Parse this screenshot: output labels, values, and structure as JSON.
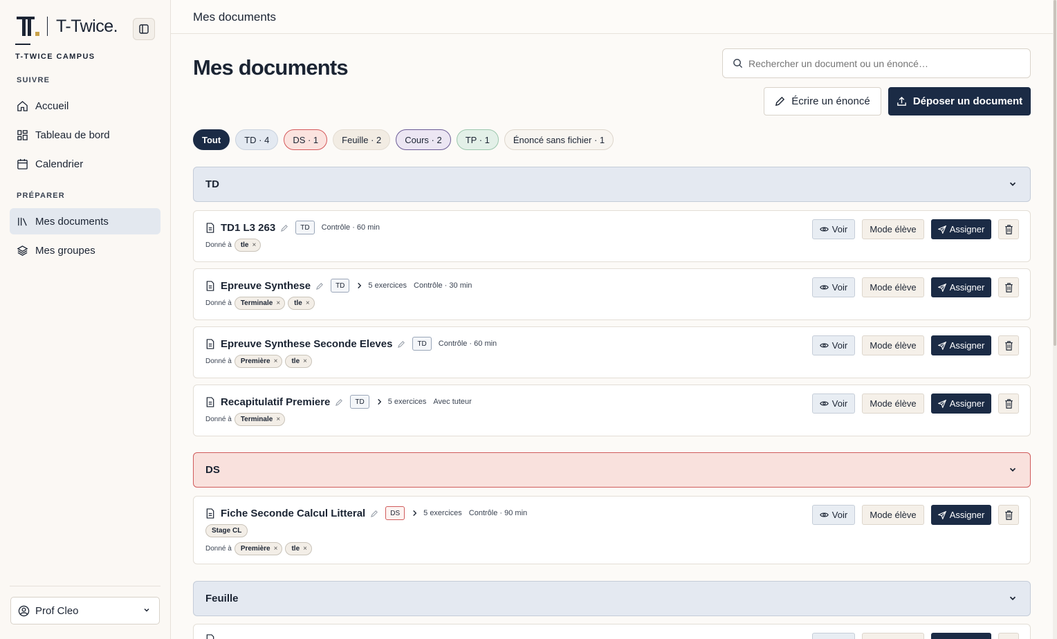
{
  "sidebar": {
    "brand": "T-Twice.",
    "campus": "T-TWICE CAMPUS",
    "section_follow": "SUIVRE",
    "section_prepare": "PRÉPARER",
    "items": [
      {
        "label": "Accueil",
        "icon": "home-icon"
      },
      {
        "label": "Tableau de bord",
        "icon": "dashboard-icon"
      },
      {
        "label": "Calendrier",
        "icon": "calendar-icon"
      },
      {
        "label": "Mes documents",
        "icon": "library-icon",
        "active": true
      },
      {
        "label": "Mes groupes",
        "icon": "layers-icon"
      }
    ],
    "profile": "Prof Cleo"
  },
  "topbar": {
    "title": "Mes documents"
  },
  "main": {
    "title": "Mes documents",
    "search_placeholder": "Rechercher un document ou un énoncé…",
    "write_label": "Écrire un énoncé",
    "upload_label": "Déposer un document",
    "filters": [
      "Tout",
      "TD · 4",
      "DS · 1",
      "Feuille · 2",
      "Cours · 2",
      "TP · 1",
      "Énoncé sans fichier · 1"
    ],
    "actions": {
      "view": "Voir",
      "student_mode": "Mode élève",
      "assign": "Assigner"
    },
    "given_label": "Donné à",
    "groups": {
      "td": "TD",
      "ds": "DS",
      "feuille": "Feuille"
    },
    "docs": [
      {
        "title": "TD1 L3 263",
        "type": "TD",
        "meta": "Contrôle · 60 min",
        "tags": [
          "tle"
        ]
      },
      {
        "title": "Epreuve Synthese",
        "type": "TD",
        "exercises": "5 exercices",
        "meta": "Contrôle · 30 min",
        "tags": [
          "Terminale",
          "tle"
        ]
      },
      {
        "title": "Epreuve Synthese Seconde Eleves",
        "type": "TD",
        "meta": "Contrôle · 60 min",
        "tags": [
          "Première",
          "tle"
        ]
      },
      {
        "title": "Recapitulatif Premiere",
        "type": "TD",
        "exercises": "5 exercices",
        "meta": "Avec tuteur",
        "tags": [
          "Terminale"
        ]
      },
      {
        "title": "Fiche Seconde Calcul Litteral",
        "type": "DS",
        "exercises": "5 exercices",
        "meta": "Contrôle · 90 min",
        "stage": "Stage CL",
        "tags": [
          "Première",
          "tle"
        ]
      }
    ]
  },
  "colors": {
    "accent": "#1b2b45",
    "ds": "#d05b5b",
    "td_bg": "#e4e9f1"
  }
}
